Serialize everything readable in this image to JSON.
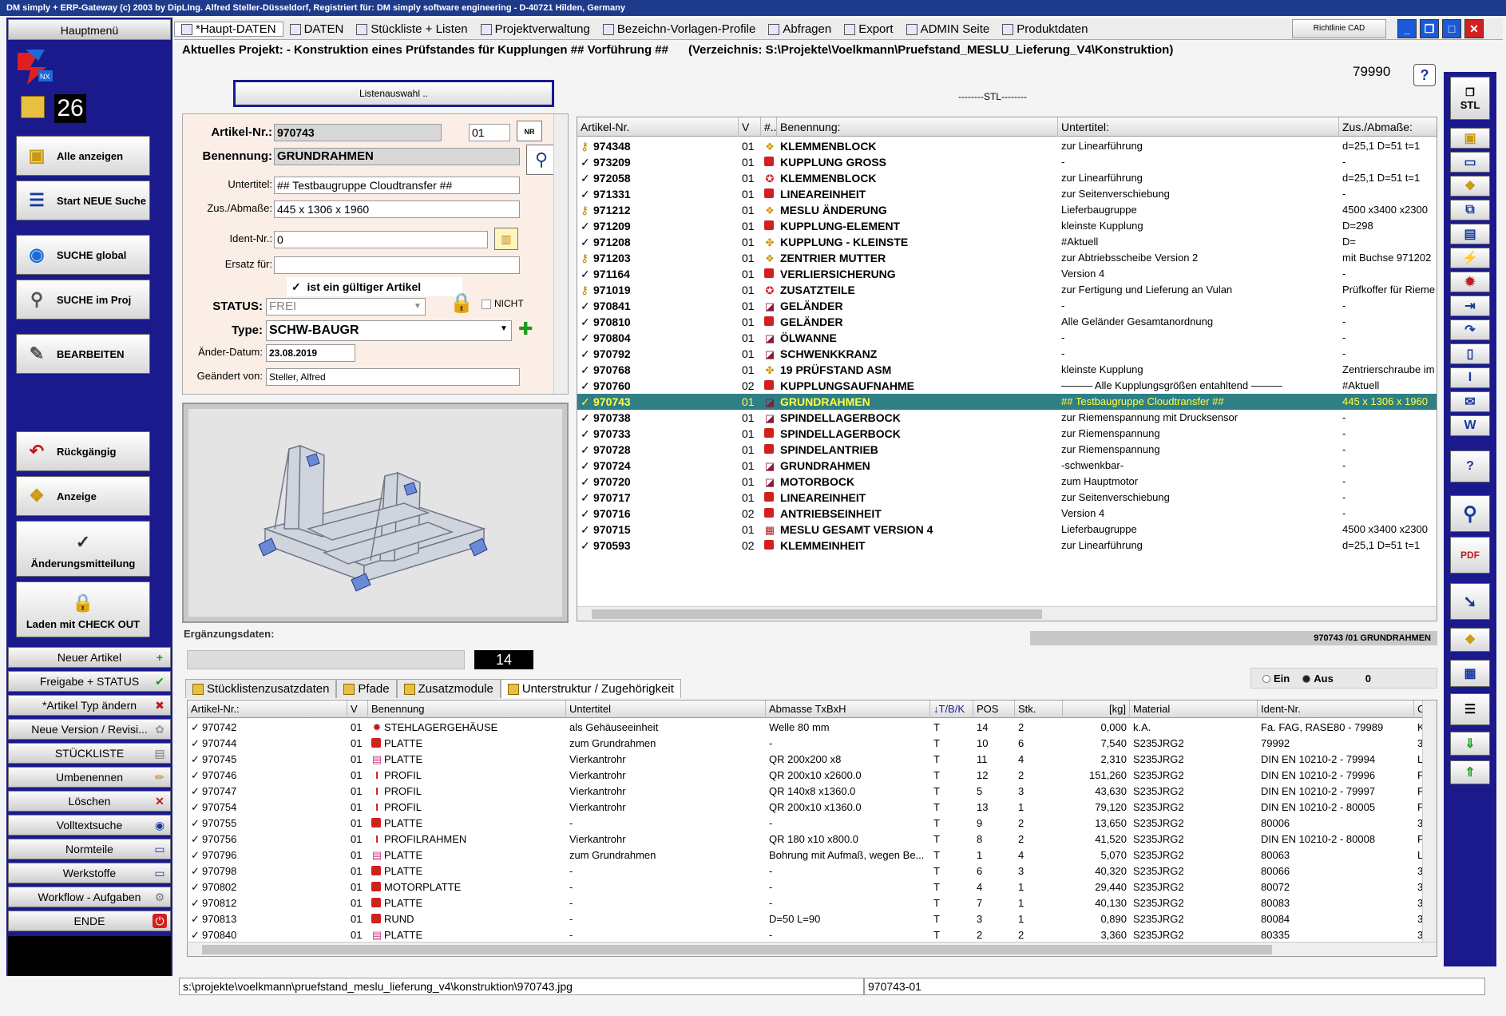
{
  "window": {
    "title": "DM simply + ERP-Gateway (c) 2003 by DipLIng. Alfred Steller-Düsseldorf, Registriert für: DM simply software engineering - D-40721 Hilden, Germany"
  },
  "sidebar": {
    "header": "Hauptmenü",
    "count": "26",
    "buttons": [
      {
        "label": "Alle anzeigen"
      },
      {
        "label": "Start NEUE Suche"
      },
      {
        "label": "SUCHE global"
      },
      {
        "label": "SUCHE im Proj"
      },
      {
        "label": "BEARBEITEN"
      },
      {
        "label": "Rückgängig"
      },
      {
        "label": "Anzeige"
      },
      {
        "label": "Änderungsmitteilung"
      },
      {
        "label": "Laden mit CHECK OUT"
      }
    ],
    "list_buttons": [
      {
        "label": "Neuer Artikel"
      },
      {
        "label": "Freigabe + STATUS"
      },
      {
        "label": "*Artikel Typ ändern"
      },
      {
        "label": "Neue Version / Revisi..."
      },
      {
        "label": "STÜCKLISTE"
      },
      {
        "label": "Umbenennen"
      },
      {
        "label": "Löschen"
      },
      {
        "label": "Volltextsuche"
      },
      {
        "label": "Normteile"
      },
      {
        "label": "Werkstoffe"
      },
      {
        "label": "Workflow - Aufgaben"
      },
      {
        "label": "ENDE"
      }
    ]
  },
  "menubar": {
    "items": [
      {
        "label": "*Haupt-DATEN"
      },
      {
        "label": "DATEN"
      },
      {
        "label": "Stückliste + Listen"
      },
      {
        "label": "Projektverwaltung"
      },
      {
        "label": "Bezeichn-Vorlagen-Profile"
      },
      {
        "label": "Abfragen"
      },
      {
        "label": "Export"
      },
      {
        "label": "ADMIN Seite"
      },
      {
        "label": "Produktdaten"
      }
    ],
    "richtlinie": "Richtlinie CAD"
  },
  "project": {
    "line": "Aktuelles Projekt: - Konstruktion eines Prüfstandes für Kupplungen ## Vorführung ##",
    "directory": "(Verzeichnis: S:\\Projekte\\Voelkmann\\Pruefstand_MESLU_Lieferung_V4\\Konstruktion)",
    "number": "79990",
    "help": "?"
  },
  "listauswahl": "Listenauswahl ..",
  "stl_label": "--------STL--------",
  "form": {
    "artikel_label": "Artikel-Nr.:",
    "artikel_value": "970743",
    "version_value": "01",
    "benennung_label": "Benennung:",
    "benennung_value": "GRUNDRAHMEN",
    "untertitel_label": "Untertitel:",
    "untertitel_value": "## Testbaugruppe Cloudtransfer ##",
    "zus_label": "Zus./Abmaße:",
    "zus_value": "445 x 1306 x 1960",
    "ident_label": "Ident-Nr.:",
    "ident_value": "0",
    "ersatz_label": "Ersatz für:",
    "ersatz_value": "",
    "valid_label": "ist ein gültiger Artikel",
    "status_label": "STATUS:",
    "status_value": "FREI",
    "nicht_label": "NICHT",
    "type_label": "Type:",
    "type_value": "SCHW-BAUGR",
    "aender_label": "Änder-Datum:",
    "aender_value": "23.08.2019",
    "geaendert_label": "Geändert von:",
    "geaendert_value": "Steller, Alfred",
    "nr_button": "NR"
  },
  "stl_grid": {
    "headers": [
      "Artikel-Nr.",
      "V",
      "#..",
      "Benennung:",
      "Untertitel:",
      "Zus./Abmaße:"
    ],
    "rows": [
      {
        "icon": "key",
        "art": "974348",
        "v": "01",
        "t": "yellow",
        "ben": "KLEMMENBLOCK",
        "unt": "zur Linearführung",
        "zus": "d=25,1 D=51 t=1"
      },
      {
        "icon": "check",
        "art": "973209",
        "v": "01",
        "t": "red",
        "ben": "KUPPLUNG GROSS",
        "unt": "-",
        "zus": "-"
      },
      {
        "icon": "check",
        "art": "972058",
        "v": "01",
        "t": "redx",
        "ben": "KLEMMENBLOCK",
        "unt": "zur Linearführung",
        "zus": "d=25,1 D=51 t=1"
      },
      {
        "icon": "check",
        "art": "971331",
        "v": "01",
        "t": "red",
        "ben": "LINEAREINHEIT",
        "unt": "zur Seitenverschiebung",
        "zus": "-"
      },
      {
        "icon": "key",
        "art": "971212",
        "v": "01",
        "t": "yellow",
        "ben": "MESLU ÄNDERUNG",
        "unt": "Lieferbaugruppe",
        "zus": "4500 x3400 x2300"
      },
      {
        "icon": "check",
        "art": "971209",
        "v": "01",
        "t": "red",
        "ben": "KUPPLUNG-ELEMENT",
        "unt": "kleinste Kupplung",
        "zus": "D=298"
      },
      {
        "icon": "check",
        "art": "971208",
        "v": "01",
        "t": "yelsm",
        "ben": "KUPPLUNG - KLEINSTE",
        "unt": "#Aktuell",
        "zus": "D="
      },
      {
        "icon": "key",
        "art": "971203",
        "v": "01",
        "t": "yellow",
        "ben": "ZENTRIER MUTTER",
        "unt": "zur Abtriebsscheibe Version 2",
        "zus": "mit Buchse 971202"
      },
      {
        "icon": "check",
        "art": "971164",
        "v": "01",
        "t": "red",
        "ben": "VERLIERSICHERUNG",
        "unt": "Version 4",
        "zus": "-"
      },
      {
        "icon": "key",
        "art": "971019",
        "v": "01",
        "t": "redx",
        "ben": "ZUSATZTEILE",
        "unt": "zur Fertigung und Lieferung an Vulan",
        "zus": "Prüfkoffer für Rieme"
      },
      {
        "icon": "check",
        "art": "970841",
        "v": "01",
        "t": "frame",
        "ben": "GELÄNDER",
        "unt": "-",
        "zus": "-"
      },
      {
        "icon": "check",
        "art": "970810",
        "v": "01",
        "t": "red",
        "ben": "GELÄNDER",
        "unt": "Alle Geländer Gesamtanordnung",
        "zus": "-"
      },
      {
        "icon": "check",
        "art": "970804",
        "v": "01",
        "t": "frame",
        "ben": "ÖLWANNE",
        "unt": "-",
        "zus": "-"
      },
      {
        "icon": "check",
        "art": "970792",
        "v": "01",
        "t": "frame",
        "ben": "SCHWENKKRANZ",
        "unt": "-",
        "zus": "-"
      },
      {
        "icon": "check",
        "art": "970768",
        "v": "01",
        "t": "yelsm",
        "ben": "19 PRÜFSTAND ASM",
        "unt": "kleinste Kupplung",
        "zus": "Zentrierschraube im"
      },
      {
        "icon": "check",
        "art": "970760",
        "v": "02",
        "t": "red",
        "ben": "KUPPLUNGSAUFNAHME",
        "unt": "——— Alle Kupplungsgrößen entahltend ———",
        "zus": "#Aktuell"
      },
      {
        "icon": "check",
        "art": "970743",
        "v": "01",
        "t": "frame",
        "ben": "GRUNDRAHMEN",
        "unt": "## Testbaugruppe Cloudtransfer ##",
        "zus": "445 x 1306 x 1960",
        "sel": true
      },
      {
        "icon": "check",
        "art": "970738",
        "v": "01",
        "t": "frame",
        "ben": "SPINDELLAGERBOCK",
        "unt": "zur Riemenspannung mit Drucksensor",
        "zus": "-"
      },
      {
        "icon": "check",
        "art": "970733",
        "v": "01",
        "t": "red",
        "ben": "SPINDELLAGERBOCK",
        "unt": "zur Riemenspannung",
        "zus": "-"
      },
      {
        "icon": "check",
        "art": "970728",
        "v": "01",
        "t": "red",
        "ben": "SPINDELANTRIEB",
        "unt": "zur Riemenspannung",
        "zus": "-"
      },
      {
        "icon": "check",
        "art": "970724",
        "v": "01",
        "t": "frame",
        "ben": "GRUNDRAHMEN",
        "unt": "-schwenkbar-",
        "zus": "-"
      },
      {
        "icon": "check",
        "art": "970720",
        "v": "01",
        "t": "frame",
        "ben": "MOTORBOCK",
        "unt": "zum Hauptmotor",
        "zus": "-"
      },
      {
        "icon": "check",
        "art": "970717",
        "v": "01",
        "t": "red",
        "ben": "LINEAREINHEIT",
        "unt": "zur Seitenverschiebung",
        "zus": "-"
      },
      {
        "icon": "check",
        "art": "970716",
        "v": "02",
        "t": "red",
        "ben": "ANTRIEBSEINHEIT",
        "unt": "Version 4",
        "zus": "-"
      },
      {
        "icon": "check",
        "art": "970715",
        "v": "01",
        "t": "asm",
        "ben": "MESLU GESAMT VERSION 4",
        "unt": "Lieferbaugruppe",
        "zus": "4500 x3400 x2300"
      },
      {
        "icon": "check",
        "art": "970593",
        "v": "02",
        "t": "red",
        "ben": "KLEMMEINHEIT",
        "unt": "zur Linearführung",
        "zus": "d=25,1 D=51 t=1"
      }
    ]
  },
  "ergaenzung": {
    "label": "Ergänzungsdaten:",
    "count": "14",
    "bar_text": "970743 /01  GRUNDRAHMEN",
    "radio_ein": "Ein",
    "radio_aus": "Aus",
    "radio_value": "0"
  },
  "tabs": [
    {
      "label": "Stücklistenzusatzdaten"
    },
    {
      "label": "Pfade"
    },
    {
      "label": "Zusatzmodule"
    },
    {
      "label": "Unterstruktur / Zugehörigkeit"
    }
  ],
  "sub_grid": {
    "headers": [
      "Artikel-Nr.:",
      "V",
      "Benennung",
      "Untertitel",
      "Abmasse TxBxH",
      "T/B/K",
      "POS",
      "Stk.",
      "[kg]",
      "Material",
      "Ident-Nr.",
      "C"
    ],
    "rows": [
      {
        "art": "970742",
        "v": "01",
        "t": "gear",
        "ben": "STEHLAGERGEHÄUSE",
        "unt": "als Gehäuseeinheit",
        "abm": "Welle 80 mm",
        "tbk": "T",
        "pos": "14",
        "stk": "2",
        "kg": "0,000",
        "mat": "k.A.",
        "ident": "Fa. FAG, RASE80 - 79989",
        "c": "K"
      },
      {
        "art": "970744",
        "v": "01",
        "t": "red",
        "ben": "PLATTE",
        "unt": "zum Grundrahmen",
        "abm": "-",
        "tbk": "T",
        "pos": "10",
        "stk": "6",
        "kg": "7,540",
        "mat": "S235JRG2",
        "ident": "79992",
        "c": "3"
      },
      {
        "art": "970745",
        "v": "01",
        "t": "pink",
        "ben": "PLATTE",
        "unt": "Vierkantrohr",
        "abm": "QR 200x200 x8",
        "tbk": "T",
        "pos": "11",
        "stk": "4",
        "kg": "2,310",
        "mat": "S235JRG2",
        "ident": "DIN EN 10210-2 - 79994",
        "c": "L"
      },
      {
        "art": "970746",
        "v": "01",
        "t": "profil",
        "ben": "PROFIL",
        "unt": "Vierkantrohr",
        "abm": "QR 200x10 x2600.0",
        "tbk": "T",
        "pos": "12",
        "stk": "2",
        "kg": "151,260",
        "mat": "S235JRG2",
        "ident": "DIN EN 10210-2 - 79996",
        "c": "F"
      },
      {
        "art": "970747",
        "v": "01",
        "t": "profil",
        "ben": "PROFIL",
        "unt": "Vierkantrohr",
        "abm": "QR 140x8 x1360.0",
        "tbk": "T",
        "pos": "5",
        "stk": "3",
        "kg": "43,630",
        "mat": "S235JRG2",
        "ident": "DIN EN 10210-2 - 79997",
        "c": "F"
      },
      {
        "art": "970754",
        "v": "01",
        "t": "profil",
        "ben": "PROFIL",
        "unt": "Vierkantrohr",
        "abm": "QR 200x10 x1360.0",
        "tbk": "T",
        "pos": "13",
        "stk": "1",
        "kg": "79,120",
        "mat": "S235JRG2",
        "ident": "DIN EN 10210-2 - 80005",
        "c": "F"
      },
      {
        "art": "970755",
        "v": "01",
        "t": "red",
        "ben": "PLATTE",
        "unt": "-",
        "abm": "-",
        "tbk": "T",
        "pos": "9",
        "stk": "2",
        "kg": "13,650",
        "mat": "S235JRG2",
        "ident": "80006",
        "c": "3"
      },
      {
        "art": "970756",
        "v": "01",
        "t": "profil",
        "ben": "PROFILRAHMEN",
        "unt": "Vierkantrohr",
        "abm": "QR 180 x10 x800.0",
        "tbk": "T",
        "pos": "8",
        "stk": "2",
        "kg": "41,520",
        "mat": "S235JRG2",
        "ident": "DIN EN 10210-2 - 80008",
        "c": "F"
      },
      {
        "art": "970796",
        "v": "01",
        "t": "pink",
        "ben": "PLATTE",
        "unt": "zum Grundrahmen",
        "abm": "Bohrung mit Aufmaß, wegen Be...",
        "tbk": "T",
        "pos": "1",
        "stk": "4",
        "kg": "5,070",
        "mat": "S235JRG2",
        "ident": "80063",
        "c": "L"
      },
      {
        "art": "970798",
        "v": "01",
        "t": "red",
        "ben": "PLATTE",
        "unt": "-",
        "abm": "-",
        "tbk": "T",
        "pos": "6",
        "stk": "3",
        "kg": "40,320",
        "mat": "S235JRG2",
        "ident": "80066",
        "c": "3"
      },
      {
        "art": "970802",
        "v": "01",
        "t": "red",
        "ben": "MOTORPLATTE",
        "unt": "-",
        "abm": "-",
        "tbk": "T",
        "pos": "4",
        "stk": "1",
        "kg": "29,440",
        "mat": "S235JRG2",
        "ident": "80072",
        "c": "3"
      },
      {
        "art": "970812",
        "v": "01",
        "t": "red",
        "ben": "PLATTE",
        "unt": "-",
        "abm": "-",
        "tbk": "T",
        "pos": "7",
        "stk": "1",
        "kg": "40,130",
        "mat": "S235JRG2",
        "ident": "80083",
        "c": "3"
      },
      {
        "art": "970813",
        "v": "01",
        "t": "red",
        "ben": "RUND",
        "unt": "-",
        "abm": "D=50 L=90",
        "tbk": "T",
        "pos": "3",
        "stk": "1",
        "kg": "0,890",
        "mat": "S235JRG2",
        "ident": "80084",
        "c": "3"
      },
      {
        "art": "970840",
        "v": "01",
        "t": "pink",
        "ben": "PLATTE",
        "unt": "-",
        "abm": "-",
        "tbk": "T",
        "pos": "2",
        "stk": "2",
        "kg": "3,360",
        "mat": "S235JRG2",
        "ident": "80335",
        "c": "3"
      }
    ]
  },
  "status": {
    "path": "s:\\projekte\\voelkmann\\pruefstand_meslu_lieferung_v4\\konstruktion\\970743.jpg",
    "id": "970743-01"
  },
  "right_toolbar": {
    "stl_label": "STL",
    "help": "?"
  },
  "colors": {
    "frame_blue": "#1a1a8c",
    "selected_row": "#2e7f86",
    "selected_text": "#ffff40"
  }
}
